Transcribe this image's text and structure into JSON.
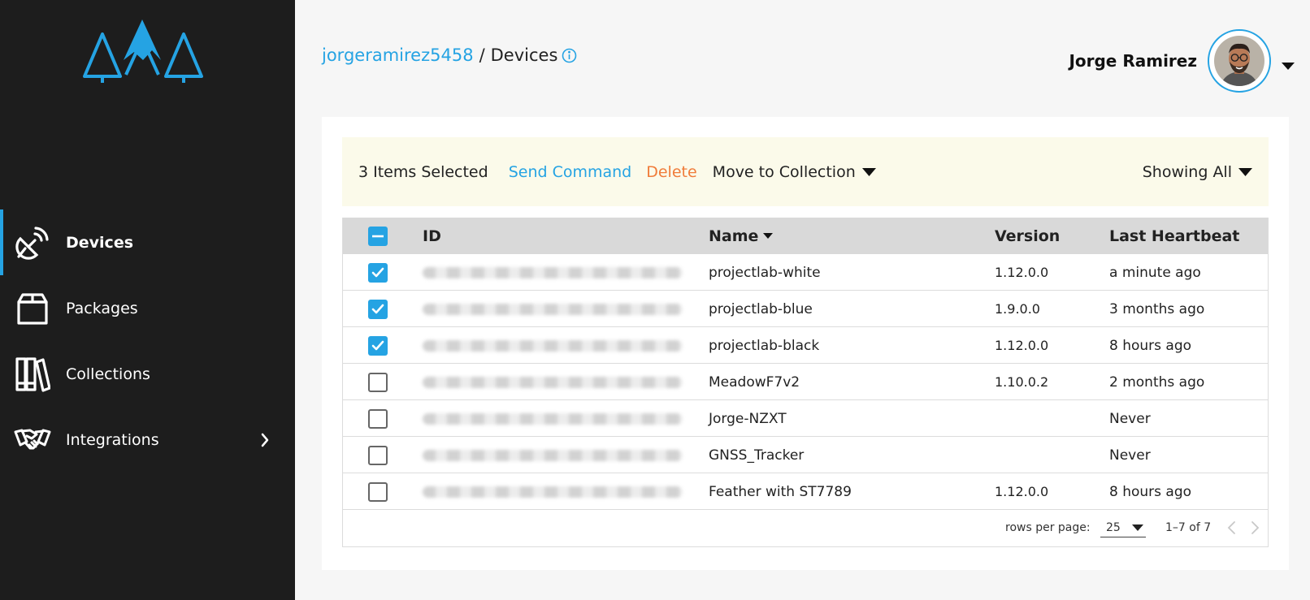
{
  "sidebar": {
    "items": [
      {
        "label": "Devices",
        "icon": "satellite-dish-icon"
      },
      {
        "label": "Packages",
        "icon": "package-box-icon"
      },
      {
        "label": "Collections",
        "icon": "books-icon"
      },
      {
        "label": "Integrations",
        "icon": "handshake-icon"
      }
    ]
  },
  "header": {
    "breadcrumb_link": "jorgeramirez5458",
    "breadcrumb_sep": "/",
    "breadcrumb_current": "Devices",
    "user_name": "Jorge Ramirez"
  },
  "toolbar": {
    "selected_count": "3 Items Selected",
    "send_command": "Send Command",
    "delete": "Delete",
    "move_to_collection": "Move to Collection",
    "showing": "Showing All"
  },
  "table": {
    "columns": {
      "id": "ID",
      "name": "Name",
      "version": "Version",
      "last_heartbeat": "Last Heartbeat"
    },
    "rows": [
      {
        "checked": true,
        "name": "projectlab-white",
        "version": "1.12.0.0",
        "last_heartbeat": "a minute ago"
      },
      {
        "checked": true,
        "name": "projectlab-blue",
        "version": "1.9.0.0",
        "last_heartbeat": "3 months ago"
      },
      {
        "checked": true,
        "name": "projectlab-black",
        "version": "1.12.0.0",
        "last_heartbeat": "8 hours ago"
      },
      {
        "checked": false,
        "name": "MeadowF7v2",
        "version": "1.10.0.2",
        "last_heartbeat": "2 months ago"
      },
      {
        "checked": false,
        "name": "Jorge-NZXT",
        "version": "",
        "last_heartbeat": "Never"
      },
      {
        "checked": false,
        "name": "GNSS_Tracker",
        "version": "",
        "last_heartbeat": "Never"
      },
      {
        "checked": false,
        "name": "Feather with ST7789",
        "version": "1.12.0.0",
        "last_heartbeat": "8 hours ago"
      }
    ]
  },
  "pagination": {
    "rows_per_page_label": "rows per page:",
    "rows_per_page": "25",
    "range": "1–7 of 7"
  },
  "colors": {
    "accent": "#25a3e3",
    "delete": "#f07c3a",
    "sidebar_bg": "#1d1d1d",
    "toolbar_bg": "#fbfaea",
    "header_bg": "#d9d9d9"
  }
}
